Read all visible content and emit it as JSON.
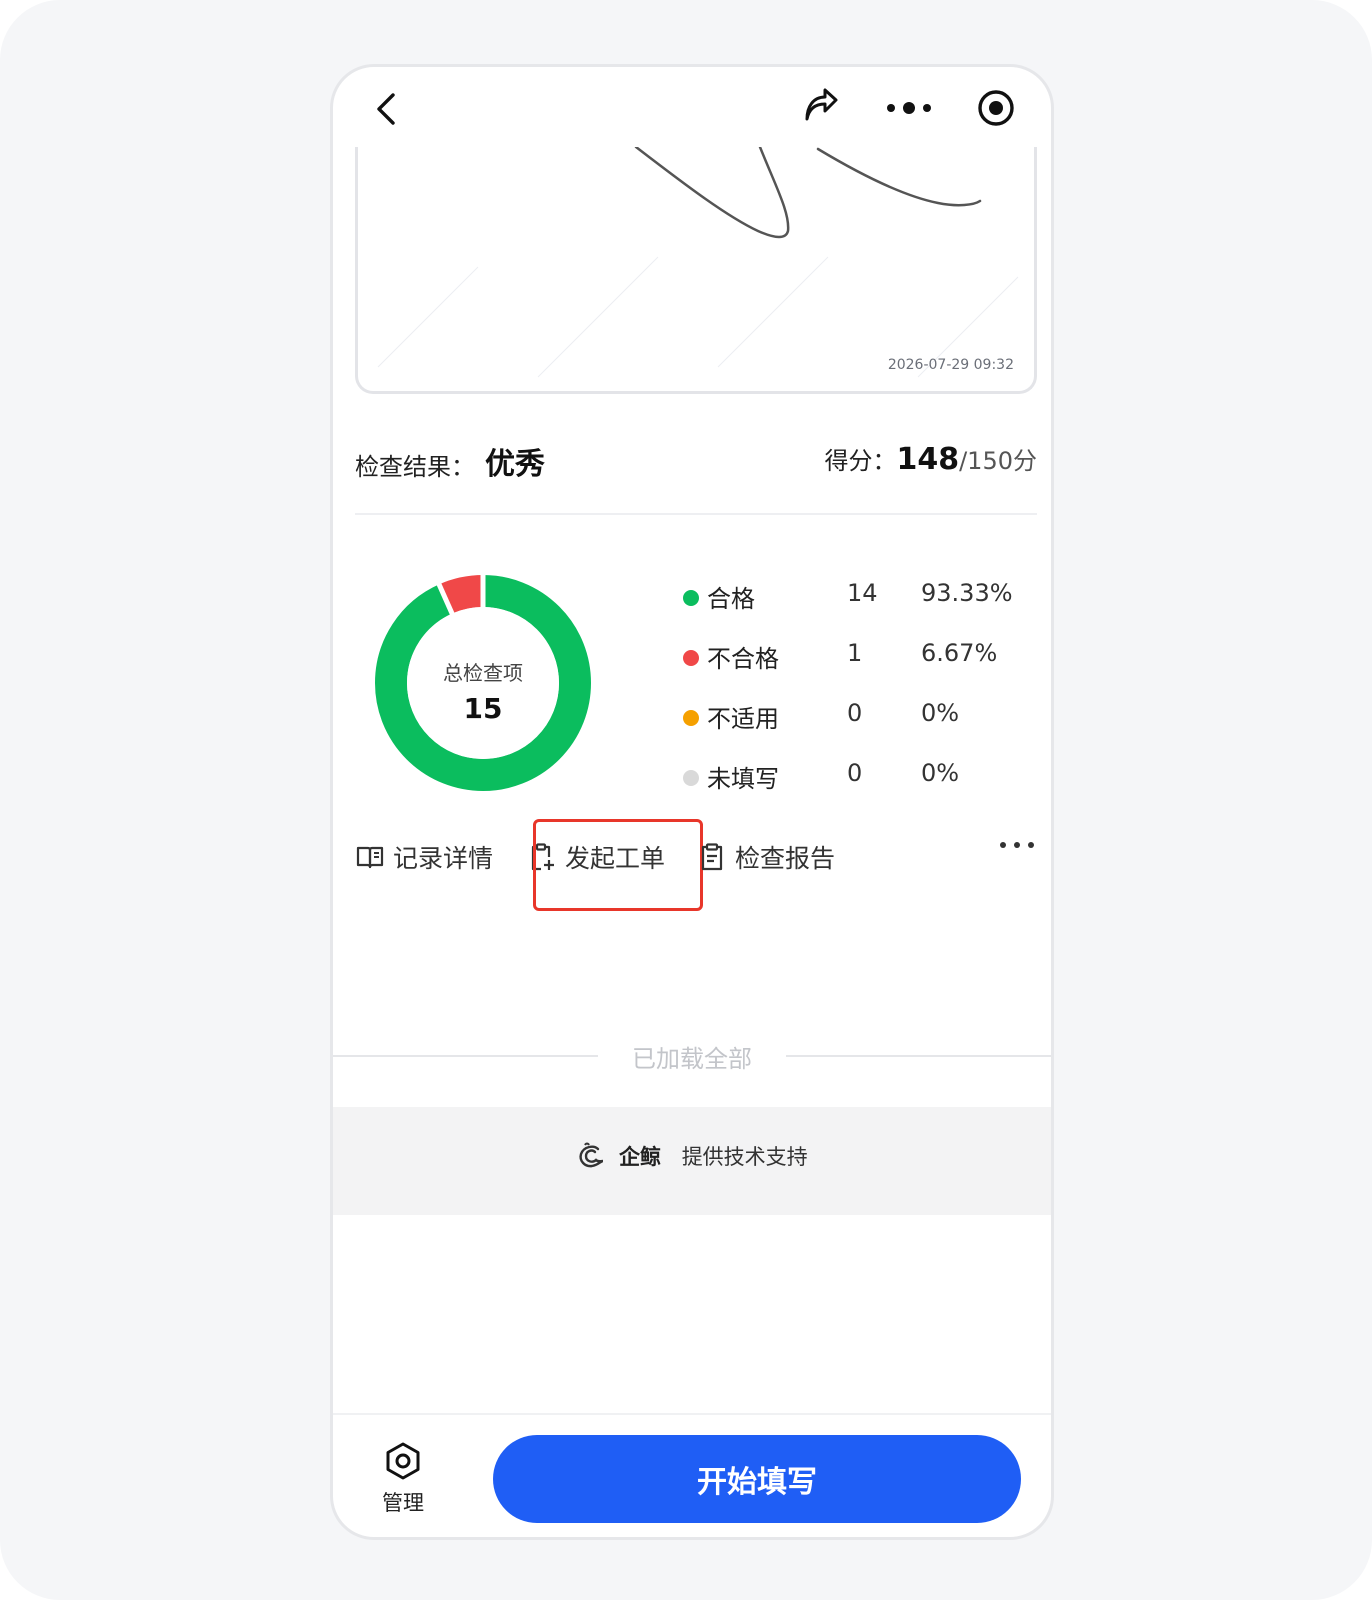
{
  "signature": {
    "timestamp": "2026-07-29 09:32"
  },
  "result": {
    "label": "检查结果：",
    "value": "优秀",
    "score_label": "得分：",
    "score_value": "148",
    "score_total": "/150分"
  },
  "summary": {
    "center_label": "总检查项",
    "center_value": "15",
    "legend": [
      {
        "name": "合格",
        "count": "14",
        "percent": "93.33%",
        "color": "#0bbd5e"
      },
      {
        "name": "不合格",
        "count": "1",
        "percent": "6.67%",
        "color": "#f04848"
      },
      {
        "name": "不适用",
        "count": "0",
        "percent": "0%",
        "color": "#f5a000"
      },
      {
        "name": "未填写",
        "count": "0",
        "percent": "0%",
        "color": "#d9d9d9"
      }
    ],
    "pass_fraction": 0.9333
  },
  "actions": {
    "record_detail": "记录详情",
    "create_order": "发起工单",
    "report": "检查报告"
  },
  "list_end": "已加载全部",
  "support": {
    "brand": "企鲸",
    "text": "提供技术支持"
  },
  "bottom": {
    "manage_label": "管理",
    "start_label": "开始填写"
  },
  "colors": {
    "accent": "#1f5ef5",
    "highlight": "#e8362a"
  }
}
